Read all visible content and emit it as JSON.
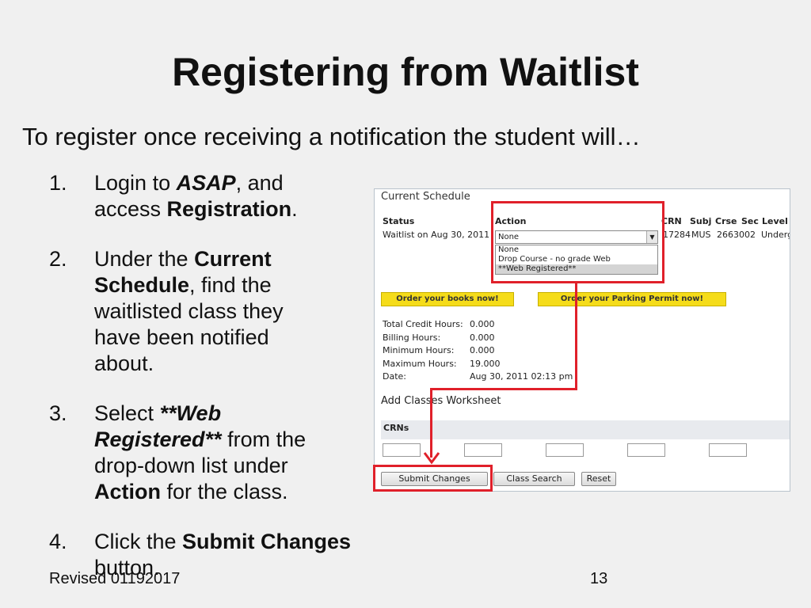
{
  "slide": {
    "title": "Registering from Waitlist",
    "subtitle": "To register once receiving a notification the student will…",
    "steps": [
      {
        "num": "1.",
        "text_a": "Login to ",
        "text_b": "ASAP",
        "text_c": ", and",
        "text_d": "access ",
        "text_e": "Registration",
        "text_f": "."
      },
      {
        "num": "2.",
        "text_a": "Under the ",
        "text_b": "Current",
        "text_c": "Schedule",
        "text_d": ", find the",
        "text_e": "waitlisted class they",
        "text_f": "have been notified",
        "text_g": "about."
      },
      {
        "num": "3.",
        "text_a": "Select ",
        "text_b": "**Web",
        "text_c": "Registered**",
        "text_d": " from the",
        "text_e": "drop-down list under",
        "text_f": "Action",
        "text_g": " for the class."
      },
      {
        "num": "4.",
        "text_a": "Click the ",
        "text_b": "Submit Changes",
        "text_c": "button."
      }
    ],
    "footer_left": "Revised 01192017",
    "page_number": "13"
  },
  "screenshot": {
    "section_title": "Current Schedule",
    "headers": {
      "status": "Status",
      "action": "Action",
      "crn": "CRN",
      "subj": "Subj",
      "crse": "Crse",
      "sec": "Sec",
      "level": "Level"
    },
    "row": {
      "status": "Waitlist on Aug 30, 2011",
      "crn": "17284",
      "subj": "MUS",
      "crse": "2663",
      "sec": "002",
      "level": "Underg"
    },
    "action_select": {
      "value": "None",
      "options": [
        "None",
        "Drop Course - no grade Web",
        "**Web Registered**"
      ]
    },
    "buttons": {
      "books": "Order your books now!",
      "parking": "Order your Parking Permit now!",
      "submit": "Submit Changes",
      "class_search": "Class Search",
      "reset": "Reset"
    },
    "stats": [
      {
        "label": "Total Credit Hours:",
        "value": "0.000"
      },
      {
        "label": "Billing Hours:",
        "value": "0.000"
      },
      {
        "label": "Minimum Hours:",
        "value": "0.000"
      },
      {
        "label": "Maximum Hours:",
        "value": "19.000"
      },
      {
        "label": "Date:",
        "value": "Aug 30, 2011 02:13 pm"
      }
    ],
    "worksheet_title": "Add Classes Worksheet",
    "crns_label": "CRNs"
  },
  "colors": {
    "highlight": "#e0202a",
    "yellow_button": "#f5dc1a",
    "background": "#f0f0f0"
  }
}
